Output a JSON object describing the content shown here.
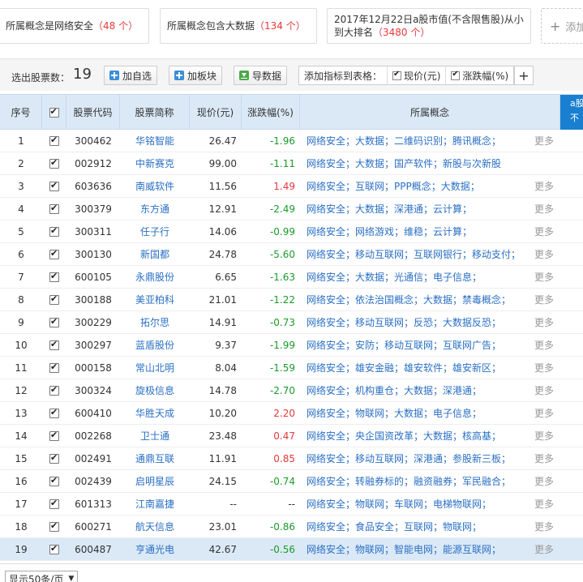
{
  "conditions": [
    {
      "text": "所属概念是网络安全",
      "count": "（48 个）"
    },
    {
      "text": "所属概念包含大数据",
      "count": "（134 个）"
    },
    {
      "line1": "2017年12月22日a股市值(不含限售股)从小",
      "line2": "到大排名",
      "count": "（3480 个）"
    }
  ],
  "add_condition_label": "添加",
  "toolbar": {
    "selected_label": "选出股票数：",
    "selected_count": "19",
    "add_self_label": "加自选",
    "add_board_label": "加板块",
    "export_label": "导数据",
    "indicator_label": "添加指标到表格：",
    "ind_price": "现价(元)",
    "ind_change": "涨跌幅(%)",
    "plus": "+"
  },
  "headers": {
    "idx": "序号",
    "code": "股票代码",
    "name": "股票简称",
    "price": "现价(元)",
    "change": "涨跌幅(%)",
    "concept": "所属概念",
    "extra_line1": "a股",
    "extra_line2": "不"
  },
  "more_label": "更多",
  "rows": [
    {
      "idx": "1",
      "code": "300462",
      "name": "华铭智能",
      "price": "26.47",
      "change": "-1.96",
      "dir": "down",
      "concept": "网络安全；大数据；二维码识别；腾讯概念；"
    },
    {
      "idx": "2",
      "code": "002912",
      "name": "中新赛克",
      "price": "99.00",
      "change": "-1.11",
      "dir": "down",
      "concept": "网络安全；大数据；国产软件；新股与次新股",
      "nomore": true
    },
    {
      "idx": "3",
      "code": "603636",
      "name": "南威软件",
      "price": "11.56",
      "change": "1.49",
      "dir": "up",
      "concept": "网络安全；互联网；PPP概念；大数据；"
    },
    {
      "idx": "4",
      "code": "300379",
      "name": "东方通",
      "price": "12.91",
      "change": "-2.49",
      "dir": "down",
      "concept": "网络安全；大数据；深港通；云计算；"
    },
    {
      "idx": "5",
      "code": "300311",
      "name": "任子行",
      "price": "14.06",
      "change": "-0.99",
      "dir": "down",
      "concept": "网络安全；网络游戏；维稳；云计算；"
    },
    {
      "idx": "6",
      "code": "300130",
      "name": "新国都",
      "price": "24.78",
      "change": "-5.60",
      "dir": "down",
      "concept": "网络安全；移动互联网；互联网银行；移动支付；"
    },
    {
      "idx": "7",
      "code": "600105",
      "name": "永鼎股份",
      "price": "6.65",
      "change": "-1.63",
      "dir": "down",
      "concept": "网络安全；大数据；光通信；电子信息；"
    },
    {
      "idx": "8",
      "code": "300188",
      "name": "美亚柏科",
      "price": "21.01",
      "change": "-1.22",
      "dir": "down",
      "concept": "网络安全；依法治国概念；大数据；禁毒概念；"
    },
    {
      "idx": "9",
      "code": "300229",
      "name": "拓尔思",
      "price": "14.91",
      "change": "-0.73",
      "dir": "down",
      "concept": "网络安全；移动互联网；反恐；大数据反恐；"
    },
    {
      "idx": "10",
      "code": "300297",
      "name": "蓝盾股份",
      "price": "9.37",
      "change": "-1.99",
      "dir": "down",
      "concept": "网络安全；安防；移动互联网；互联网广告；"
    },
    {
      "idx": "11",
      "code": "000158",
      "name": "常山北明",
      "price": "8.04",
      "change": "-1.59",
      "dir": "down",
      "concept": "网络安全；雄安金融；雄安软件；雄安新区；"
    },
    {
      "idx": "12",
      "code": "300324",
      "name": "旋极信息",
      "price": "14.78",
      "change": "-2.70",
      "dir": "down",
      "concept": "网络安全；机构重仓；大数据；深港通；"
    },
    {
      "idx": "13",
      "code": "600410",
      "name": "华胜天成",
      "price": "10.20",
      "change": "2.20",
      "dir": "up",
      "concept": "网络安全；物联网；大数据；电子信息；"
    },
    {
      "idx": "14",
      "code": "002268",
      "name": "卫士通",
      "price": "23.48",
      "change": "0.47",
      "dir": "up",
      "concept": "网络安全；央企国资改革；大数据；核高基；"
    },
    {
      "idx": "15",
      "code": "002491",
      "name": "通鼎互联",
      "price": "11.91",
      "change": "0.85",
      "dir": "up",
      "concept": "网络安全；移动互联网；深港通；参股新三板；"
    },
    {
      "idx": "16",
      "code": "002439",
      "name": "启明星辰",
      "price": "24.15",
      "change": "-0.74",
      "dir": "down",
      "concept": "网络安全；转融券标的；融资融券；军民融合；"
    },
    {
      "idx": "17",
      "code": "601313",
      "name": "江南嘉捷",
      "price": "--",
      "change": "--",
      "dir": "flat",
      "concept": "网络安全；物联网；车联网；电梯物联网；"
    },
    {
      "idx": "18",
      "code": "600271",
      "name": "航天信息",
      "price": "23.01",
      "change": "-0.86",
      "dir": "down",
      "concept": "网络安全；食品安全；互联网；物联网；"
    },
    {
      "idx": "19",
      "code": "600487",
      "name": "亨通光电",
      "price": "42.67",
      "change": "-0.56",
      "dir": "down",
      "concept": "网络安全；物联网；智能电网；能源互联网；"
    }
  ],
  "pager": {
    "label": "显示50条/页",
    "arrow": "▼"
  },
  "colors": {
    "up": "#e4393c",
    "down": "#1a9a2b",
    "link": "#2a6fc4",
    "header_bg": "#dbe9f7"
  }
}
